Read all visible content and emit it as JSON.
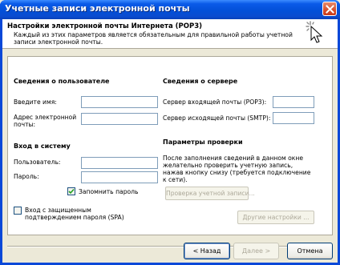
{
  "window": {
    "title": "Учетные записи электронной почты"
  },
  "header": {
    "title": "Настройки электронной почты Интернета (POP3)",
    "description": "Каждый из этих параметров является обязательным для правильной работы учетной записи электронной почты."
  },
  "user_info": {
    "section_title": "Сведения о пользователе",
    "name_label": "Введите имя:",
    "name_value": "",
    "email_label": "Адрес электронной почты:",
    "email_value": ""
  },
  "login": {
    "section_title": "Вход в систему",
    "user_label": "Пользователь:",
    "user_value": "",
    "password_label": "Пароль:",
    "password_value": "",
    "remember_label": "Запомнить пароль",
    "remember_checked": true,
    "spa_label": "Вход с защищенным подтверждением пароля (SPA)",
    "spa_checked": false
  },
  "server_info": {
    "section_title": "Сведения о сервере",
    "incoming_label": "Сервер входящей почты (POP3):",
    "incoming_value": "",
    "outgoing_label": "Сервер исходящей почты (SMTP):",
    "outgoing_value": ""
  },
  "test_settings": {
    "section_title": "Параметры проверки",
    "description": "После заполнения сведений в данном окне желательно проверить учетную запись, нажав кнопку снизу (требуется подключение к сети).",
    "test_button": "Проверка учетной записи...",
    "more_settings_button": "Другие настройки ..."
  },
  "footer": {
    "back_button": "< Назад",
    "next_button": "Далее >",
    "cancel_button": "Отмена"
  }
}
